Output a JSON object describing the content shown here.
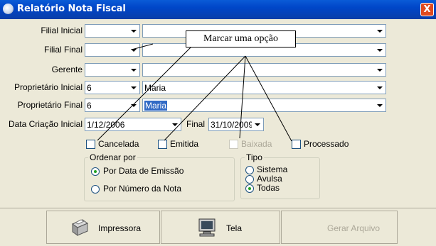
{
  "window": {
    "title": "Relatório Nota Fiscal",
    "close_label": "X"
  },
  "form": {
    "filial_inicial": {
      "label": "Filial Inicial",
      "code": "",
      "name": ""
    },
    "filial_final": {
      "label": "Filial Final",
      "code": "",
      "name": ""
    },
    "gerente": {
      "label": "Gerente",
      "code": "",
      "name": ""
    },
    "proprietario_inicial": {
      "label": "Proprietário Inicial",
      "code": "6",
      "name": "Maria"
    },
    "proprietario_final": {
      "label": "Proprietário Final",
      "code": "6",
      "name": "Maria"
    },
    "data_criacao_inicial": {
      "label": "Data Criação Inicial",
      "value": "1/12/2006"
    },
    "data_final": {
      "label": "Final",
      "value": "31/10/2009"
    }
  },
  "checkboxes": {
    "cancelada": "Cancelada",
    "emitida": "Emitida",
    "baixada": "Baixada",
    "processado": "Processado"
  },
  "ordenar_por": {
    "title": "Ordenar por",
    "options": [
      "Por Data de Emissão",
      "Por Número da Nota"
    ],
    "selected": "Por Data de Emissão"
  },
  "tipo": {
    "title": "Tipo",
    "options": [
      "Sistema",
      "Avulsa",
      "Todas"
    ],
    "selected": "Todas"
  },
  "annotation": {
    "text": "Marcar uma opção"
  },
  "buttons": {
    "impressora": "Impressora",
    "tela": "Tela",
    "gerar_arquivo": "Gerar Arquivo"
  }
}
